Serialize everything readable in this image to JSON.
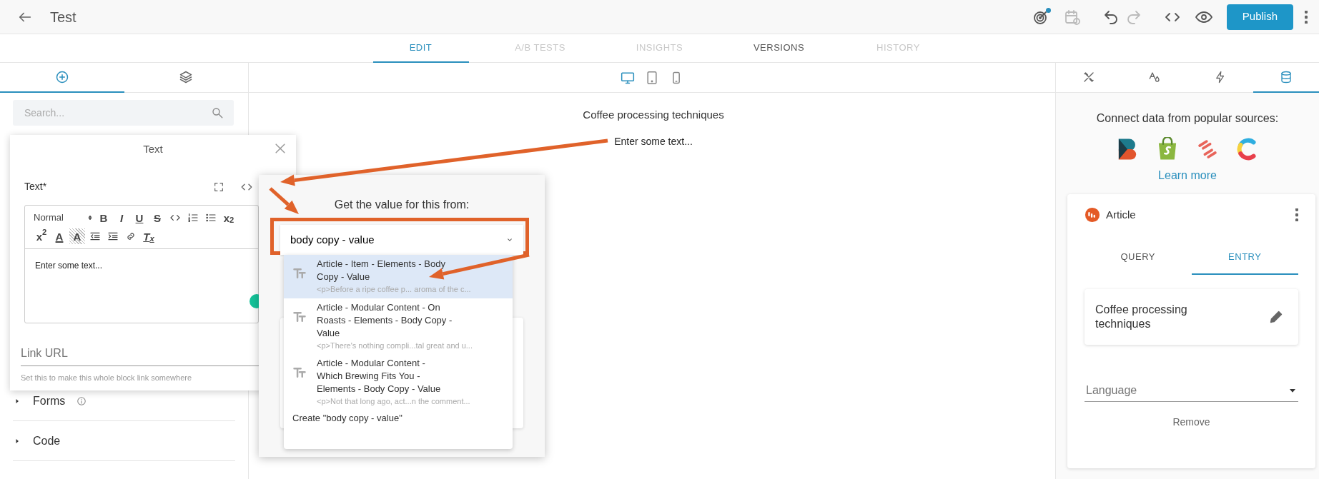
{
  "header": {
    "title": "Test",
    "publish_label": "Publish",
    "tools": [
      {
        "kind": "goal",
        "badge": true,
        "disabled": false
      },
      {
        "kind": "schedule",
        "badge": false,
        "disabled": true
      },
      {
        "kind": "undo",
        "badge": false,
        "disabled": false
      },
      {
        "kind": "redo",
        "badge": false,
        "disabled": true
      },
      {
        "kind": "code",
        "badge": false,
        "disabled": false
      },
      {
        "kind": "preview",
        "badge": false,
        "disabled": false
      }
    ]
  },
  "main_tabs": [
    {
      "label": "EDIT",
      "selected": true,
      "disabled": false
    },
    {
      "label": "A/B TESTS",
      "selected": false,
      "disabled": true
    },
    {
      "label": "INSIGHTS",
      "selected": false,
      "disabled": true
    },
    {
      "label": "VERSIONS",
      "selected": false,
      "disabled": false
    },
    {
      "label": "HISTORY",
      "selected": false,
      "disabled": true
    }
  ],
  "left_tabs": [
    {
      "kind": "add",
      "selected": true
    },
    {
      "kind": "layers",
      "selected": false
    }
  ],
  "devices": [
    {
      "kind": "desktop",
      "selected": true
    },
    {
      "kind": "tablet",
      "selected": false
    },
    {
      "kind": "phone",
      "selected": false
    }
  ],
  "right_tabs": [
    {
      "kind": "style",
      "selected": false
    },
    {
      "kind": "typography",
      "selected": false
    },
    {
      "kind": "interactions",
      "selected": false
    },
    {
      "kind": "data",
      "selected": true
    }
  ],
  "left_panel": {
    "search_placeholder": "Search...",
    "sections": [
      {
        "label": "Forms",
        "info": true
      },
      {
        "label": "Code",
        "info": false
      }
    ]
  },
  "canvas": {
    "heading": "Coffee processing techniques",
    "text": "Enter some text..."
  },
  "text_dialog": {
    "title": "Text",
    "field_label": "Text*",
    "format": "Normal",
    "toolbar": [
      {
        "kind": "bold",
        "glyph": "B"
      },
      {
        "kind": "italic",
        "glyph": "I"
      },
      {
        "kind": "underline",
        "glyph": "U"
      },
      {
        "kind": "strike",
        "glyph": "S"
      },
      {
        "kind": "code"
      },
      {
        "kind": "ordered-list"
      },
      {
        "kind": "bullet-list"
      },
      {
        "kind": "subscript",
        "glyph": "x$_{2}$"
      },
      {
        "kind": "superscript",
        "glyph": "x$^{2}$"
      },
      {
        "kind": "color",
        "glyph": "A"
      },
      {
        "kind": "background",
        "glyph": "A"
      },
      {
        "kind": "outdent"
      },
      {
        "kind": "indent"
      },
      {
        "kind": "link"
      },
      {
        "kind": "clean",
        "glyph": "T$_{x}$"
      }
    ],
    "content": "Enter some text...",
    "link_placeholder": "Link URL",
    "link_help": "Set this to make this whole block link somewhere"
  },
  "source_dialog": {
    "title": "Get the value for this from:",
    "value": "body copy - value",
    "options": [
      {
        "title": "Article - Item - Elements - Body Copy - Value",
        "preview": "<p>Before a ripe coffee p... aroma of the c...",
        "selected": true
      },
      {
        "title": "Article - Modular Content - On Roasts - Elements - Body Copy - Value",
        "preview": "<p>There's nothing compli...tal great and u...",
        "selected": false
      },
      {
        "title": "Article - Modular Content - Which Brewing Fits You - Elements - Body Copy - Value",
        "preview": "<p>Not that long ago, act...n the comment...",
        "selected": false
      }
    ],
    "create_label": "Create \"body copy - value\""
  },
  "data_panel": {
    "intro": "Connect data from popular sources:",
    "sources": [
      {
        "kind": "stacked"
      },
      {
        "kind": "bag"
      },
      {
        "kind": "stripes"
      },
      {
        "kind": "ring"
      }
    ],
    "learn_more": "Learn more",
    "source": {
      "name": "Article",
      "tabs": [
        {
          "label": "QUERY",
          "selected": false
        },
        {
          "label": "ENTRY",
          "selected": true
        }
      ],
      "entry": "Coffee processing techniques",
      "language_placeholder": "Language",
      "remove_label": "Remove"
    }
  }
}
